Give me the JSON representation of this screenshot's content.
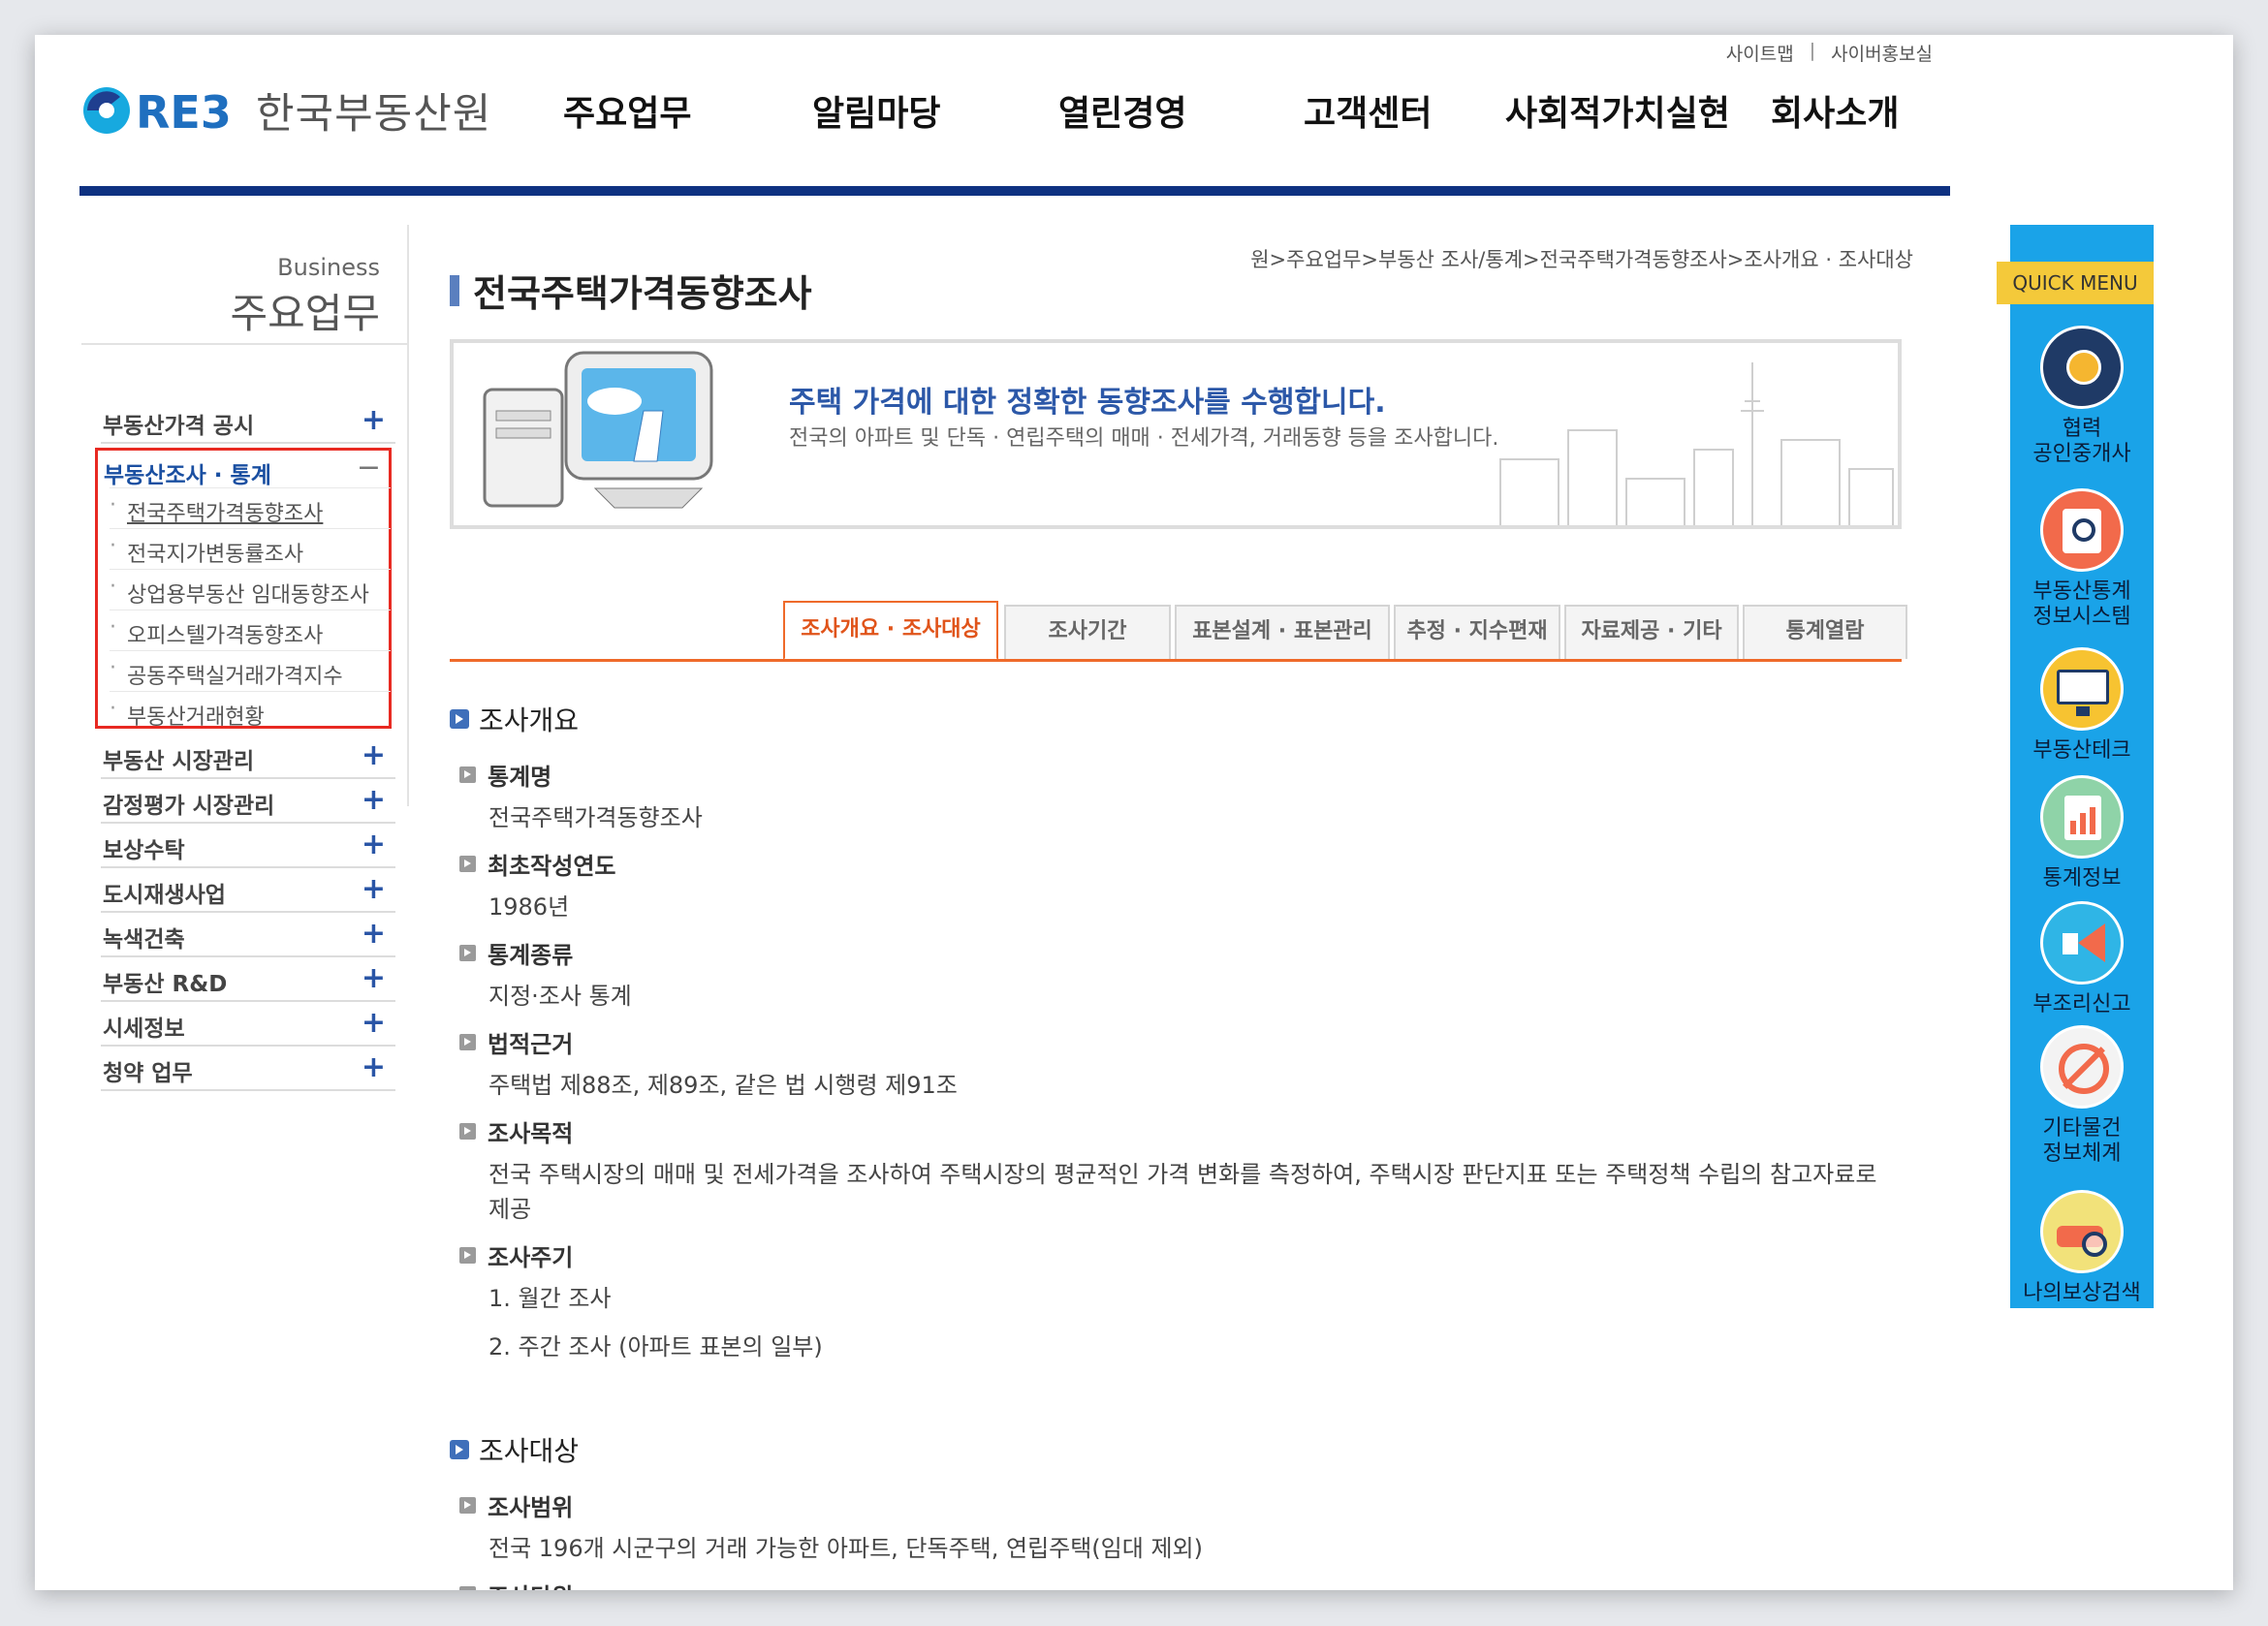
{
  "util_links": [
    "사이트맵",
    "사이버홍보실"
  ],
  "util_sep": "|",
  "logo": {
    "text": "한국부동산원"
  },
  "gnb": [
    "주요업무",
    "알림마당",
    "열린경영",
    "고객센터",
    "사회적가치실현",
    "회사소개"
  ],
  "lnb": {
    "head_en": "Business",
    "head_ko": "주요업무",
    "items": [
      "부동산가격 공시",
      "부동산조사 · 통계",
      "부동산 시장관리",
      "감정평가 시장관리",
      "보상수탁",
      "도시재생사업",
      "녹색건축",
      "부동산 R&D",
      "시세정보",
      "청약 업무"
    ],
    "plus": "+",
    "minus": "−",
    "sub_dot": "·",
    "sub_items": [
      "전국주택가격동향조사",
      "전국지가변동률조사",
      "상업용부동산 임대동향조사",
      "오피스텔가격동향조사",
      "공동주택실거래가격지수",
      "부동산거래현황"
    ]
  },
  "page": {
    "title": "전국주택가격동향조사",
    "breadcrumb": "원>주요업무>부동산 조사/통계>전국주택가격동향조사>조사개요 · 조사대상"
  },
  "banner": {
    "title": "주택 가격에 대한 정확한 동향조사를 수행합니다.",
    "subtitle": "전국의 아파트 및 단독 · 연립주택의 매매 · 전세가격, 거래동향 등을 조사합니다."
  },
  "tabs": [
    "조사개요 · 조사대상",
    "조사기간",
    "표본설계 · 표본관리",
    "추정 · 지수편재",
    "자료제공 · 기타",
    "통계열람"
  ],
  "sections": {
    "overview": {
      "title": "조사개요",
      "items": [
        {
          "label": "통계명",
          "value": "전국주택가격동향조사"
        },
        {
          "label": "최초작성연도",
          "value": "1986년"
        },
        {
          "label": "통계종류",
          "value": "지정·조사 통계"
        },
        {
          "label": "법적근거",
          "value": "주택법 제88조, 제89조, 같은 법 시행령 제91조"
        },
        {
          "label": "조사목적",
          "value": "전국 주택시장의 매매 및 전세가격을 조사하여 주택시장의 평균적인 가격 변화를 측정하여, 주택시장 판단지표 또는 주택정책 수립의 참고자료로",
          "value2": "제공"
        },
        {
          "label": "조사주기",
          "value": "1. 월간 조사",
          "value2": "2. 주간 조사 (아파트 표본의 일부)"
        }
      ]
    },
    "target": {
      "title": "조사대상",
      "items": [
        {
          "label": "조사범위",
          "value": "전국 196개 시군구의 거래 가능한 아파트, 단독주택, 연립주택(임대 제외)"
        },
        {
          "label": "조사단위"
        }
      ]
    }
  },
  "quick": {
    "label": "QUICK MENU",
    "items": [
      {
        "line1": "협력",
        "line2": "공인중개사",
        "color": "#1f3a66",
        "icon": "medal-icon"
      },
      {
        "line1": "부동산통계",
        "line2": "정보시스템",
        "color": "#f26a4b",
        "icon": "magnifier-icon"
      },
      {
        "line1": "부동산테크",
        "line2": "",
        "color": "#f7c331",
        "icon": "monitor-icon"
      },
      {
        "line1": "통계정보",
        "line2": "",
        "color": "#8fd3a8",
        "icon": "bar-chart-icon"
      },
      {
        "line1": "부조리신고",
        "line2": "",
        "color": "#2fb5e6",
        "icon": "megaphone-icon"
      },
      {
        "line1": "기타물건",
        "line2": "정보체계",
        "color": "#f3f3f3",
        "icon": "prohibited-icon"
      },
      {
        "line1": "나의보상검색",
        "line2": "",
        "color": "#f2e27a",
        "icon": "car-search-icon"
      }
    ]
  }
}
